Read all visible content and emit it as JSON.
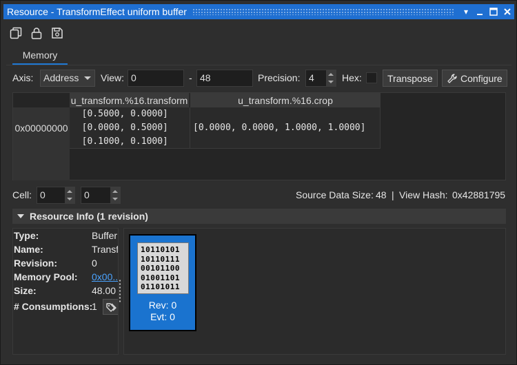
{
  "window": {
    "title": "Resource - TransformEffect uniform buffer",
    "buttons": {
      "pin": "▾",
      "minimize": "▁",
      "maximize": "□",
      "close": "✕"
    }
  },
  "toolbar": {
    "icons": [
      "copy-icon",
      "lock-icon",
      "save-icon"
    ]
  },
  "tabs": [
    {
      "label": "Memory",
      "active": true
    }
  ],
  "controls": {
    "axis_label": "Axis:",
    "axis_value": "Address",
    "view_label": "View:",
    "view_start": "0",
    "view_sep": "-",
    "view_end": "48",
    "precision_label": "Precision:",
    "precision_value": "4",
    "hex_label": "Hex:",
    "transpose_label": "Transpose",
    "configure_label": "Configure"
  },
  "table": {
    "columns": [
      "u_transform.%16.transform",
      "u_transform.%16.crop"
    ],
    "rows": [
      {
        "address": "0x00000000",
        "transform": [
          "  [0.5000, 0.0000]",
          "  [0.0000, 0.5000]",
          "  [0.1000, 0.1000]"
        ],
        "crop": "[0.0000, 0.0000, 1.0000, 1.0000]"
      }
    ]
  },
  "cell_row": {
    "cell_label": "Cell:",
    "cell_x": "0",
    "cell_y": "0",
    "source_size_label": "Source Data Size:",
    "source_size_value": "48",
    "separator": "|",
    "view_hash_label": "View Hash:",
    "view_hash_value": "0x42881795"
  },
  "resource_info": {
    "header": "Resource Info (1 revision)",
    "fields": [
      {
        "key": "Type:",
        "value": "Buffer"
      },
      {
        "key": "Name:",
        "value": "Transf"
      },
      {
        "key": "Revision:",
        "value": "0"
      },
      {
        "key": "Memory Pool:",
        "value": "0x00..."
      },
      {
        "key": "Size:",
        "value": "48.00"
      },
      {
        "key": "# Consumptions:",
        "value": "1"
      }
    ]
  },
  "revision_card": {
    "binary_lines": [
      "10110101",
      "10110111",
      "00101100",
      "01001101",
      "01101011"
    ],
    "rev": "Rev: 0",
    "evt": "Evt: 0"
  },
  "colors": {
    "accent": "#1f6fd1",
    "card": "#1a73cf",
    "link": "#4aa3ff"
  }
}
